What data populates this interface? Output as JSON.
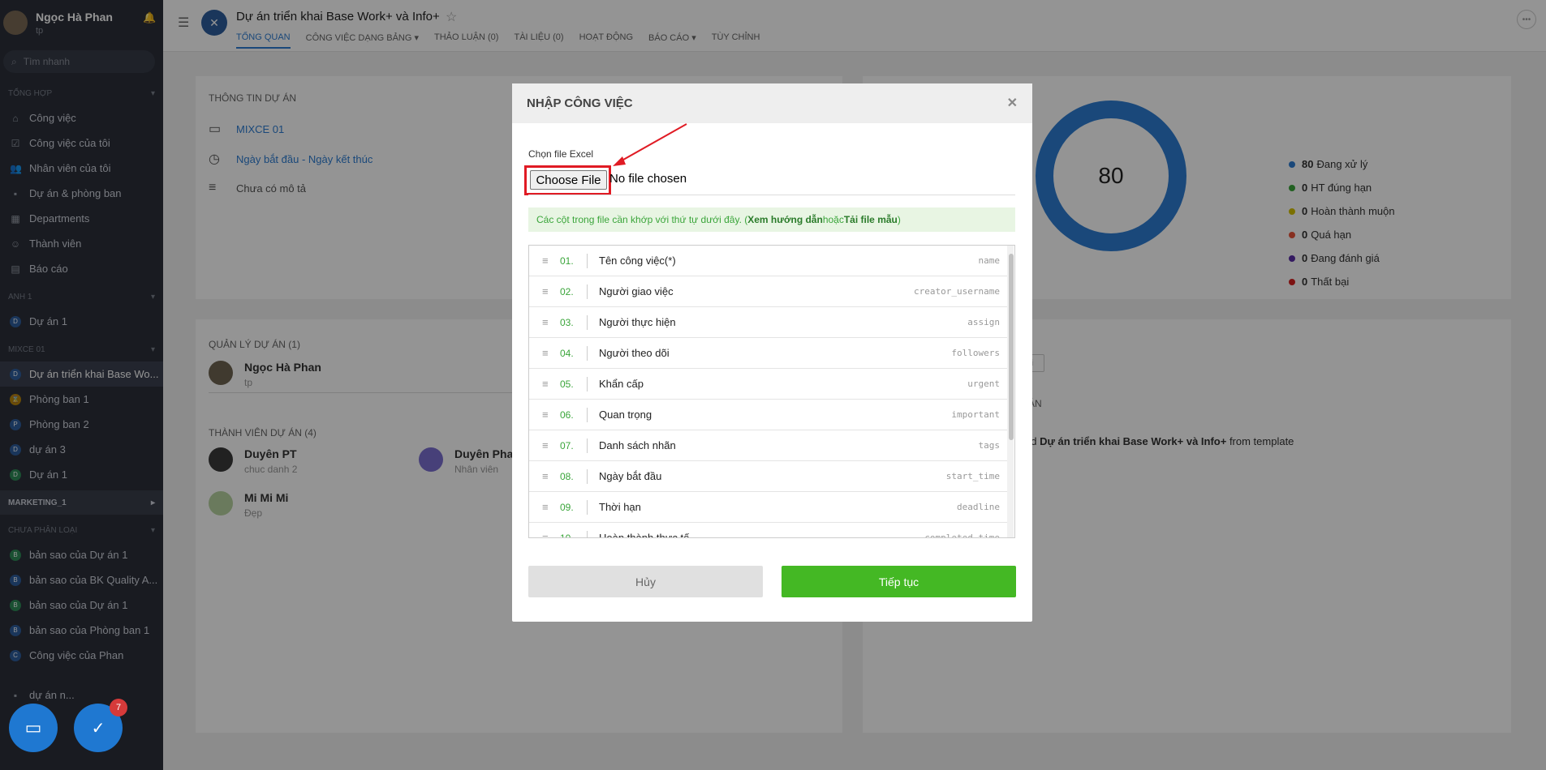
{
  "sidebar": {
    "user_name": "Ngọc Hà Phan",
    "user_sub": "tp",
    "search_placeholder": "Tìm nhanh",
    "section_tong_hop": "TỔNG HỢP",
    "main_items": [
      {
        "label": "Công việc",
        "icon": "home-icon"
      },
      {
        "label": "Công việc của tôi",
        "icon": "checklist-icon"
      },
      {
        "label": "Nhân viên của tôi",
        "icon": "users-icon"
      },
      {
        "label": "Dự án & phòng ban",
        "icon": "folder-icon"
      },
      {
        "label": "Departments",
        "icon": "grid-icon"
      },
      {
        "label": "Thành viên",
        "icon": "person-icon"
      },
      {
        "label": "Báo cáo",
        "icon": "chart-icon"
      }
    ],
    "section_anh": "ANH 1",
    "anh_items": [
      {
        "badge": "D",
        "label": "Dự án 1",
        "color": "#2d5e9e"
      }
    ],
    "section_mixce": "MIXCE 01",
    "mixce_items": [
      {
        "badge": "D",
        "label": "Dự án triển khai Base Wo...",
        "color": "#2d5e9e"
      },
      {
        "badge": "⌛",
        "label": "Phòng ban 1",
        "color": "#b8860b"
      },
      {
        "badge": "P",
        "label": "Phòng ban 2",
        "color": "#2d5e9e"
      },
      {
        "badge": "D",
        "label": "dự án 3",
        "color": "#2d5e9e"
      },
      {
        "badge": "D",
        "label": "Dự án 1",
        "color": "#2e8b57"
      }
    ],
    "section_marketing": "MARKETING_1",
    "section_chua": "CHƯA PHÂN LOẠI",
    "chua_items": [
      {
        "badge": "B",
        "label": "bản sao của Dự án 1",
        "color": "#2e8b57"
      },
      {
        "badge": "B",
        "label": "bản sao của BK Quality A...",
        "color": "#2d5e9e"
      },
      {
        "badge": "B",
        "label": "bản sao của Dự án 1",
        "color": "#2e8b57"
      },
      {
        "badge": "B",
        "label": "bản sao của Phòng ban 1",
        "color": "#2d5e9e"
      },
      {
        "badge": "C",
        "label": "Công việc của Phan",
        "color": "#2d5e9e"
      }
    ],
    "partial_item": "dự án n..."
  },
  "header": {
    "title": "Dự án triển khai Base Work+ và Info+",
    "tabs": [
      "TỔNG QUAN",
      "CÔNG VIỆC Dạng bảng ▾",
      "THẢO LUẬN (0)",
      "TÀI LIỆU (0)",
      "HOẠT ĐỘNG",
      "BÁO CÁO ▾",
      "TÙY CHỈNH"
    ]
  },
  "info": {
    "heading": "THÔNG TIN DỰ ÁN",
    "folder": "MIXCE 01",
    "dates": "Ngày bắt đầu - Ngày kết thúc",
    "desc": "Chưa có mô tả"
  },
  "stats": {
    "total": "80",
    "legend": [
      {
        "count": "80",
        "label": "Đang xử lý",
        "color": "#2d7dd2"
      },
      {
        "count": "0",
        "label": "HT đúng hạn",
        "color": "#3aa53a"
      },
      {
        "count": "0",
        "label": "Hoàn thành muộn",
        "color": "#d4c200"
      },
      {
        "count": "0",
        "label": "Quá hạn",
        "color": "#e8543a"
      },
      {
        "count": "0",
        "label": "Đang đánh giá",
        "color": "#5a2da8"
      },
      {
        "count": "0",
        "label": "Thất bại",
        "color": "#d62020"
      }
    ]
  },
  "managers": {
    "heading": "QUẢN LÝ DỰ ÁN (1)",
    "name": "Ngọc Hà Phan",
    "role": "tp"
  },
  "members": {
    "heading": "THÀNH VIÊN DỰ ÁN (4)",
    "list": [
      {
        "name": "Duyên PT",
        "role": "chuc danh 2"
      },
      {
        "name": "Duyên Phan",
        "role": "Nhân viên"
      },
      {
        "name": "Mi Mi Mi",
        "role": "Đẹp"
      }
    ]
  },
  "activity": {
    "tag": "thái",
    "heading": "ÁN",
    "line_pre": "ed ",
    "line_bold": "Dự án triển khai Base Work+ và Info+",
    "line_post": " from template"
  },
  "modal": {
    "title": "NHẬP CÔNG VIỆC",
    "file_label": "Chọn file Excel",
    "choose_file": "Choose File",
    "no_file": "No file chosen",
    "note_pre": "Các cột trong file cần khớp với thứ tự dưới đây. (",
    "note_link1": "Xem hướng dẫn",
    "note_mid": " hoặc ",
    "note_link2": "Tải file mẫu",
    "note_post": ")",
    "columns": [
      {
        "no": "01.",
        "label": "Tên công việc(*)",
        "key": "name"
      },
      {
        "no": "02.",
        "label": "Người giao việc",
        "key": "creator_username"
      },
      {
        "no": "03.",
        "label": "Người thực hiện",
        "key": "assign"
      },
      {
        "no": "04.",
        "label": "Người theo dõi",
        "key": "followers"
      },
      {
        "no": "05.",
        "label": "Khẩn cấp",
        "key": "urgent"
      },
      {
        "no": "06.",
        "label": "Quan trọng",
        "key": "important"
      },
      {
        "no": "07.",
        "label": "Danh sách nhãn",
        "key": "tags"
      },
      {
        "no": "08.",
        "label": "Ngày bắt đầu",
        "key": "start_time"
      },
      {
        "no": "09.",
        "label": "Thời hạn",
        "key": "deadline"
      },
      {
        "no": "10.",
        "label": "Hoàn thành thực tế",
        "key": "completed_time"
      }
    ],
    "cancel": "Hủy",
    "continue": "Tiếp tục"
  },
  "float": {
    "task_count": "7"
  }
}
